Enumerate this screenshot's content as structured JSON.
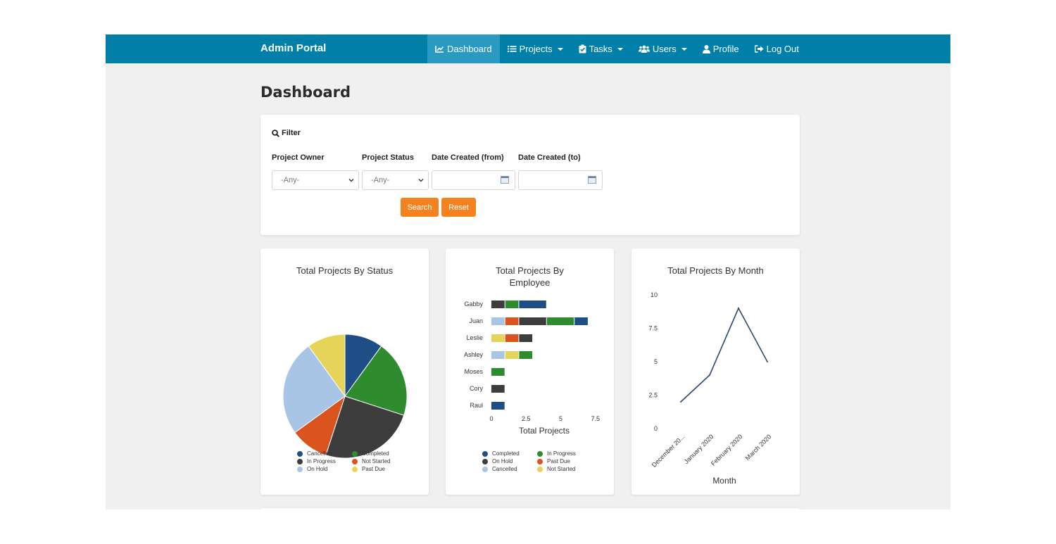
{
  "navbar": {
    "brand": "Admin Portal",
    "items": [
      {
        "label": "Dashboard",
        "icon": "chart-line-icon",
        "active": true,
        "dropdown": false
      },
      {
        "label": "Projects",
        "icon": "list-icon",
        "active": false,
        "dropdown": true
      },
      {
        "label": "Tasks",
        "icon": "clipboard-check-icon",
        "active": false,
        "dropdown": true
      },
      {
        "label": "Users",
        "icon": "users-icon",
        "active": false,
        "dropdown": true
      },
      {
        "label": "Profile",
        "icon": "user-icon",
        "active": false,
        "dropdown": false
      },
      {
        "label": "Log Out",
        "icon": "sign-out-icon",
        "active": false,
        "dropdown": false
      }
    ]
  },
  "page": {
    "title": "Dashboard"
  },
  "filter": {
    "title": "Filter",
    "fields": {
      "owner": {
        "label": "Project Owner",
        "value": "-Any-"
      },
      "status": {
        "label": "Project Status",
        "value": "-Any-"
      },
      "date_from": {
        "label": "Date Created (from)",
        "value": ""
      },
      "date_to": {
        "label": "Date Created (to)",
        "value": ""
      }
    },
    "search_label": "Search",
    "reset_label": "Reset"
  },
  "colors": {
    "navbar": "#0080a8",
    "navbar_active": "#2a9ac2",
    "button": "#f58220",
    "dark_blue": "#1f4e86",
    "green": "#2e8b2e",
    "dark_gray": "#3d3d3d",
    "orange": "#d9541e",
    "light_blue": "#a9c5e6",
    "yellow": "#e6d35a",
    "line": "#2c4a6e"
  },
  "chart_data": [
    {
      "type": "pie",
      "title": "Total Projects By Status",
      "labels": [
        "Cancelled",
        "Completed",
        "In Progress",
        "Not Started",
        "On Hold",
        "Past Due"
      ],
      "values": [
        2,
        4,
        5,
        2,
        5,
        2
      ],
      "colors": [
        "#1f4e86",
        "#2e8b2e",
        "#3d3d3d",
        "#d9541e",
        "#a9c5e6",
        "#e6d35a"
      ],
      "legend_position": "bottom"
    },
    {
      "type": "bar",
      "orientation": "horizontal",
      "stacked": true,
      "title": "Total Projects By Employee",
      "xlabel": "Total Projects",
      "ylabel": "",
      "xlim": [
        0,
        7.5
      ],
      "xticks": [
        "0",
        "2.5",
        "5",
        "7.5"
      ],
      "categories": [
        "Gabby",
        "Juan",
        "Leslie",
        "Ashley",
        "Moses",
        "Cory",
        "Raul"
      ],
      "series": [
        {
          "name": "Cancelled",
          "color": "#a9c5e6",
          "values": [
            0,
            1,
            0,
            1,
            0,
            0,
            0
          ]
        },
        {
          "name": "Not Started",
          "color": "#e6d35a",
          "values": [
            0,
            0,
            1,
            1,
            0,
            0,
            0
          ]
        },
        {
          "name": "Past Due",
          "color": "#d9541e",
          "values": [
            0,
            1,
            1,
            0,
            0,
            0,
            0
          ]
        },
        {
          "name": "On Hold",
          "color": "#3d3d3d",
          "values": [
            1,
            2,
            1,
            0,
            0,
            1,
            0
          ]
        },
        {
          "name": "In Progress",
          "color": "#2e8b2e",
          "values": [
            1,
            2,
            0,
            1,
            1,
            0,
            0
          ]
        },
        {
          "name": "Completed",
          "color": "#1f4e86",
          "values": [
            2,
            1,
            0,
            0,
            0,
            0,
            1
          ]
        }
      ],
      "legend": [
        {
          "name": "Completed",
          "color": "#1f4e86"
        },
        {
          "name": "In Progress",
          "color": "#2e8b2e"
        },
        {
          "name": "On Hold",
          "color": "#3d3d3d"
        },
        {
          "name": "Past Due",
          "color": "#d9541e"
        },
        {
          "name": "Cancelled",
          "color": "#a9c5e6"
        },
        {
          "name": "Not Started",
          "color": "#e6d35a"
        }
      ],
      "legend_position": "bottom"
    },
    {
      "type": "line",
      "title": "Total Projects By Month",
      "xlabel": "Month",
      "ylabel": "",
      "x": [
        "December 20...",
        "January 2020",
        "February 2020",
        "March 2020"
      ],
      "values": [
        2,
        4,
        9,
        5
      ],
      "ylim": [
        0,
        10
      ],
      "yticks": [
        "0",
        "2.5",
        "5",
        "7.5",
        "10"
      ],
      "color": "#2c4a6e"
    }
  ]
}
